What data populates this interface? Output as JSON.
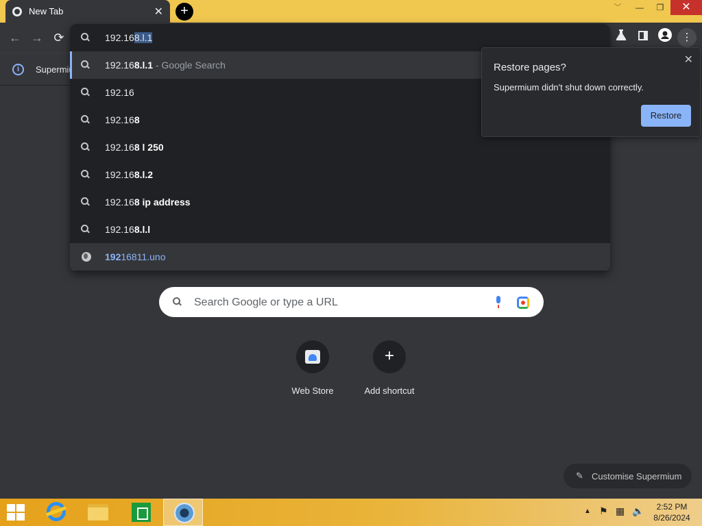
{
  "tab": {
    "title": "New Tab",
    "close": "✕"
  },
  "window": {
    "new_tab": "+",
    "chevron": "﹀",
    "minimize": "—",
    "maximize": "❐",
    "close": "✕"
  },
  "toolbar": {
    "back": "←",
    "forward": "→",
    "reload": "⟳",
    "menu": "⋮"
  },
  "infobar": {
    "text": "Supermiu"
  },
  "omnibox": {
    "typed": "192.16",
    "selected": "8.l.1",
    "suggestions": [
      {
        "pre": "192.16",
        "bold": "8.l.1",
        "suffix": " - Google Search",
        "kind": "search"
      },
      {
        "pre": "192.16",
        "bold": "",
        "suffix": "",
        "kind": "search"
      },
      {
        "pre": "192.16",
        "bold": "8",
        "suffix": "",
        "kind": "search"
      },
      {
        "pre": "192.16",
        "bold": "8 l 250",
        "suffix": "",
        "kind": "search"
      },
      {
        "pre": "192.16",
        "bold": "8.l.2",
        "suffix": "",
        "kind": "search"
      },
      {
        "pre": "192.16",
        "bold": "8 ip address",
        "suffix": "",
        "kind": "search"
      },
      {
        "pre": "192.16",
        "bold": "8.l.l",
        "suffix": "",
        "kind": "search"
      },
      {
        "pre": "",
        "bold": "192",
        "suffix": "16811.uno",
        "kind": "url"
      }
    ]
  },
  "restore": {
    "title": "Restore pages?",
    "message": "Supermium didn't shut down correctly.",
    "button": "Restore",
    "close": "✕"
  },
  "ntp": {
    "search_placeholder": "Search Google or type a URL",
    "shortcuts": [
      {
        "label": "Web Store"
      },
      {
        "label": "Add shortcut"
      }
    ],
    "customise": "Customise Supermium"
  },
  "taskbar": {
    "time": "2:52 PM",
    "date": "8/26/2024"
  },
  "colors": {
    "accent": "#8ab4f8",
    "background": "#35363a",
    "omnibox": "#202124",
    "taskbar": "#e5a11a",
    "close_red": "#c7312c"
  }
}
